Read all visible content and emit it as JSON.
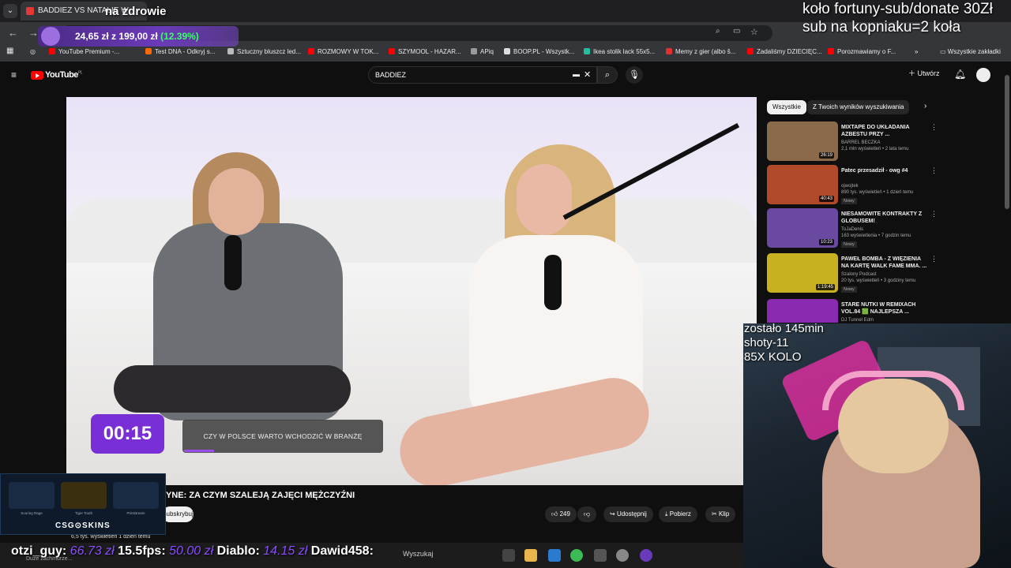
{
  "browser": {
    "tab_title": "BADDIEZ VS NATALIE W...",
    "bookmarks": [
      "YouTube Premium -...",
      "Test DNA - Odkryj s...",
      "Sztuczny bluszcz led...",
      "ROZMOWY W TOK...",
      "SZYMOOL - HAZAR...",
      "APiq",
      "BOOP.PL - Wszystk...",
      "Ikea stolik lack 55x5...",
      "Memy z gier (albo š...",
      "Zadaliśmy DZIECIĘC...",
      "Porozmawiamy o F..."
    ],
    "all_bookmarks": "Wszystkie zakładki",
    "bookmark_colors": [
      "#ff0000",
      "#ff6a00",
      "#bbbbbb",
      "#ff0000",
      "#ff0000",
      "#999999",
      "#dddddd",
      "#1fbfa0",
      "#e23030",
      "#ff0000",
      "#ff0000"
    ]
  },
  "youtube": {
    "logo": "YouTube",
    "logo_country": "PL",
    "search_value": "BADDIEZ",
    "create_label": "Utwórz",
    "chips": [
      "Wszystkie",
      "Z Twoich wyników wyszukiwania"
    ],
    "video_title": "YNE: ZA CZYM SZALEJĄ ZAJĘCI MĘŻCZYŹNI",
    "subscribe_label": "Subskrybuj",
    "likes": "249",
    "share_label": "Udostępnij",
    "download_label": "Pobierz",
    "clip_label": "Klip",
    "views_line": "6,5 tys. wyświetleń  1 dzień temu",
    "overlay_timer": "00:15",
    "overlay_caption": "CZY W POLSCE WARTO WCHODZIĆ W BRANŻĘ",
    "recommendations": [
      {
        "title": "MIXTAPE DO UKŁADANIA AZBESTU PRZY ...",
        "channel": "BARREL BECZKA",
        "meta": "2,1 mln wyświetleń • 2 lata temu",
        "duration": "26:19",
        "is_new": false,
        "thumb": "#8a6a4a"
      },
      {
        "title": "Patec przesadził - owg #4",
        "channel": "ojwojtek",
        "meta": "890 tys. wyświetleń • 1 dzień temu",
        "duration": "40:43",
        "is_new": true,
        "new_label": "Nowy",
        "thumb": "#b04a2a"
      },
      {
        "title": "NIESAMOWITE KONTRAKTY Z GLOBUSEM!",
        "channel": "ToJaDenis",
        "meta": "163 wyświetlenia • 7 godzin temu",
        "duration": "10:23",
        "is_new": true,
        "new_label": "Nowy",
        "thumb": "#6a4aa0"
      },
      {
        "title": "PAWEŁ BOMBA - Z WIĘZIENIA NA KARTĘ WALK FAME MMA. ...",
        "channel": "Szalony Podcast",
        "meta": "20 tys. wyświetleń • 3 godziny temu",
        "duration": "1:19:45",
        "is_new": true,
        "new_label": "Nowy",
        "thumb": "#c8b020"
      },
      {
        "title": "STARE NUTKI W REMIXACH VOL.84 🟩 NAJLEPSZA ...",
        "channel": "DJ Tunnel Edm",
        "meta": "",
        "duration": "",
        "is_new": false,
        "thumb": "#8a2ab0"
      }
    ]
  },
  "overlay": {
    "nazdrowie": "na zdrowie",
    "donate_line1": "koło fortuny-sub/donate 30Zł",
    "donate_line2": "sub na kopniaku=2 koła",
    "price_current": "24,65 zł",
    "price_sep": "z",
    "price_total": "199,00 zł",
    "price_pct": "(12.39%)",
    "stats": "zostało 145min\nshoty-11\n85X KOLO",
    "csgo_label": "CSG⊙SKINS",
    "skins": [
      "Souring Rage",
      "Tiger Tooth",
      "Printstream"
    ],
    "ticker": [
      {
        "name": "otzi_guy:",
        "amount": "66.73 zł"
      },
      {
        "name": "15.5fps:",
        "amount": "50.00 zł"
      },
      {
        "name": "Diablo:",
        "amount": "14.15 zł"
      },
      {
        "name": "Dawid458:",
        "amount": ""
      }
    ],
    "ticker_sub": "Duże zachmurze...",
    "taskbar_search": "Wyszukaj"
  }
}
